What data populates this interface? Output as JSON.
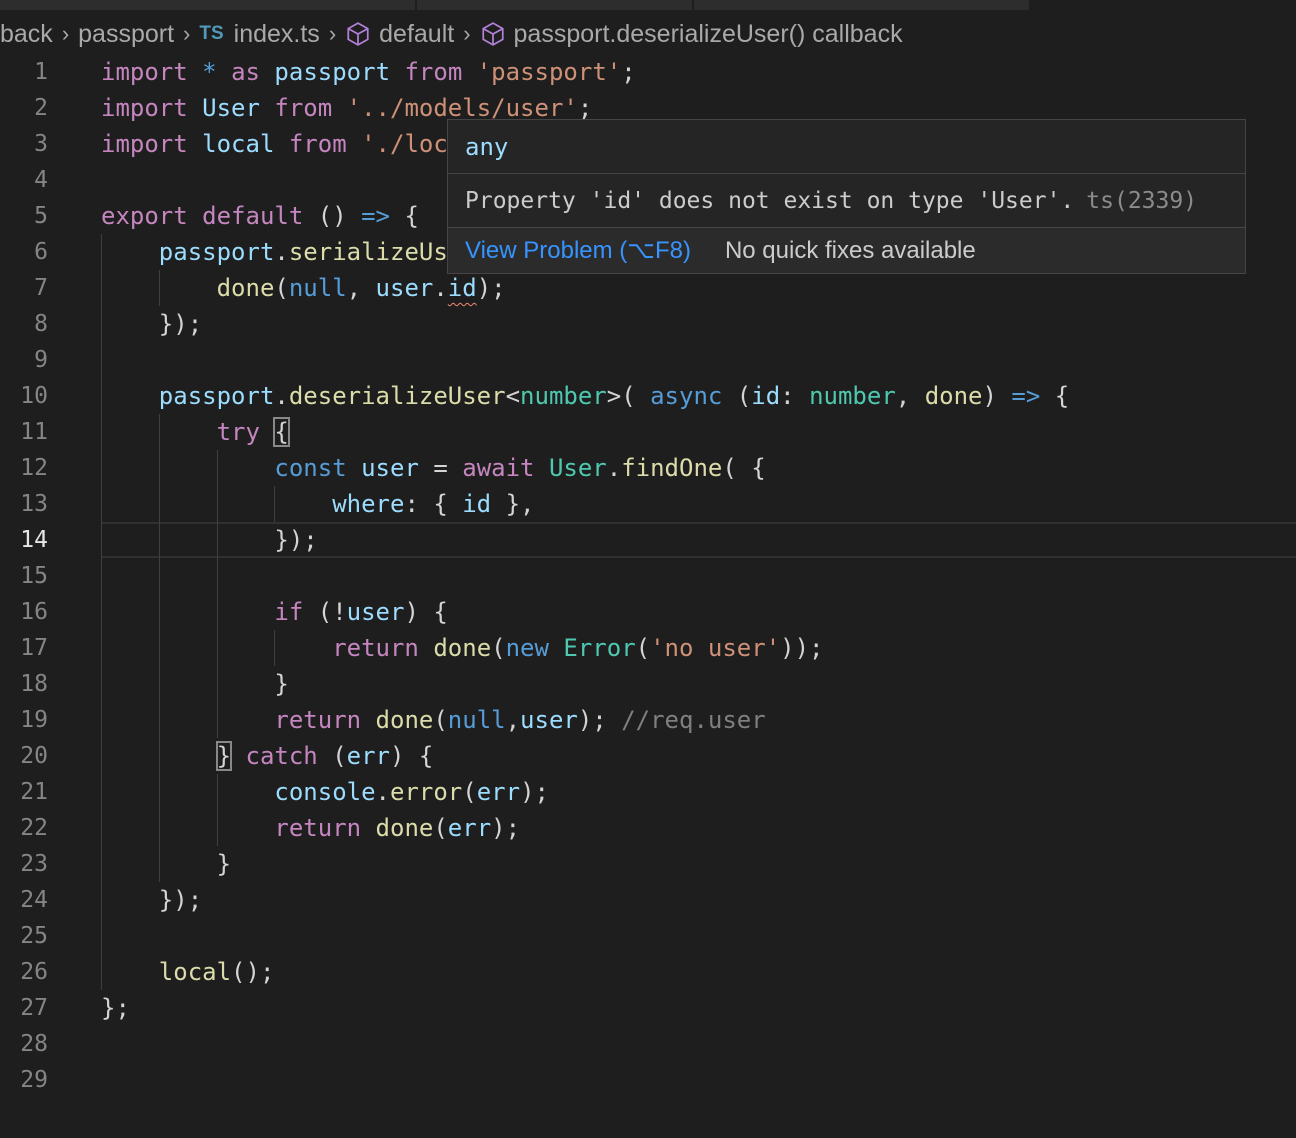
{
  "breadcrumb": {
    "items": [
      "back",
      "passport",
      "index.ts",
      "default",
      "passport.deserializeUser() callback"
    ],
    "file_badge": "TS"
  },
  "colors": {
    "kw": "#c586c0",
    "var": "#9cdcfe",
    "str": "#ce9178",
    "fn": "#dcdcaa",
    "type": "#4ec9b0",
    "blue": "#569cd6",
    "cmt": "#7f7f7f",
    "txt": "#d4d4d4",
    "background": "#1e1e1e",
    "link": "#3794ff"
  },
  "editor": {
    "current_line": 14,
    "line_numbers": [
      "1",
      "2",
      "3",
      "4",
      "5",
      "6",
      "7",
      "8",
      "9",
      "10",
      "11",
      "12",
      "13",
      "14",
      "15",
      "16",
      "17",
      "18",
      "19",
      "20",
      "21",
      "22",
      "23",
      "24",
      "25",
      "26",
      "27",
      "28",
      "29"
    ],
    "lines": [
      [
        [
          "import",
          "kw"
        ],
        [
          " ",
          "txt"
        ],
        [
          "*",
          "blue"
        ],
        [
          " ",
          "txt"
        ],
        [
          "as",
          "kw"
        ],
        [
          " ",
          "txt"
        ],
        [
          "passport",
          "var"
        ],
        [
          " ",
          "txt"
        ],
        [
          "from",
          "kw"
        ],
        [
          " ",
          "txt"
        ],
        [
          "'passport'",
          "str"
        ],
        [
          ";",
          "txt"
        ]
      ],
      [
        [
          "import",
          "kw"
        ],
        [
          " ",
          "txt"
        ],
        [
          "User",
          "var"
        ],
        [
          " ",
          "txt"
        ],
        [
          "from",
          "kw"
        ],
        [
          " ",
          "txt"
        ],
        [
          "'../models/user'",
          "str"
        ],
        [
          ";",
          "txt"
        ]
      ],
      [
        [
          "import",
          "kw"
        ],
        [
          " ",
          "txt"
        ],
        [
          "local",
          "var"
        ],
        [
          " ",
          "txt"
        ],
        [
          "from",
          "kw"
        ],
        [
          " ",
          "txt"
        ],
        [
          "'./loc",
          "str"
        ]
      ],
      [],
      [
        [
          "export",
          "kw"
        ],
        [
          " ",
          "txt"
        ],
        [
          "default",
          "kw"
        ],
        [
          " () ",
          "txt"
        ],
        [
          "=>",
          "blue"
        ],
        [
          " {",
          "txt"
        ]
      ],
      [
        [
          "    ",
          "txt"
        ],
        [
          "passport",
          "var"
        ],
        [
          ".",
          "txt"
        ],
        [
          "serializeUs",
          "fn"
        ]
      ],
      [
        [
          "        ",
          "txt"
        ],
        [
          "done",
          "fn"
        ],
        [
          "(",
          "txt"
        ],
        [
          "null",
          "blue"
        ],
        [
          ", ",
          "txt"
        ],
        [
          "user",
          "var"
        ],
        [
          ".",
          "txt"
        ],
        [
          "id",
          "var",
          "squig"
        ],
        [
          ");",
          "txt"
        ]
      ],
      [
        [
          "    });",
          "txt"
        ]
      ],
      [],
      [
        [
          "    ",
          "txt"
        ],
        [
          "passport",
          "var"
        ],
        [
          ".",
          "txt"
        ],
        [
          "deserializeUser",
          "fn"
        ],
        [
          "<",
          "txt"
        ],
        [
          "number",
          "type"
        ],
        [
          ">( ",
          "txt"
        ],
        [
          "async",
          "blue"
        ],
        [
          " (",
          "txt"
        ],
        [
          "id",
          "var"
        ],
        [
          ": ",
          "txt"
        ],
        [
          "number",
          "type"
        ],
        [
          ", ",
          "txt"
        ],
        [
          "done",
          "fn"
        ],
        [
          ") ",
          "txt"
        ],
        [
          "=>",
          "blue"
        ],
        [
          " {",
          "txt"
        ]
      ],
      [
        [
          "        ",
          "txt"
        ],
        [
          "try",
          "kw"
        ],
        [
          " ",
          "txt"
        ],
        [
          "{",
          "txt",
          "box"
        ]
      ],
      [
        [
          "            ",
          "txt"
        ],
        [
          "const",
          "blue"
        ],
        [
          " ",
          "txt"
        ],
        [
          "user",
          "var"
        ],
        [
          " = ",
          "txt"
        ],
        [
          "await",
          "kw"
        ],
        [
          " ",
          "txt"
        ],
        [
          "User",
          "type"
        ],
        [
          ".",
          "txt"
        ],
        [
          "findOne",
          "fn"
        ],
        [
          "( {",
          "txt"
        ]
      ],
      [
        [
          "                ",
          "txt"
        ],
        [
          "where",
          "var"
        ],
        [
          ": { ",
          "txt"
        ],
        [
          "id",
          "var"
        ],
        [
          " },",
          "txt"
        ]
      ],
      [
        [
          "            });",
          "txt"
        ]
      ],
      [],
      [
        [
          "            ",
          "txt"
        ],
        [
          "if",
          "kw"
        ],
        [
          " (!",
          "txt"
        ],
        [
          "user",
          "var"
        ],
        [
          ") {",
          "txt"
        ]
      ],
      [
        [
          "                ",
          "txt"
        ],
        [
          "return",
          "kw"
        ],
        [
          " ",
          "txt"
        ],
        [
          "done",
          "fn"
        ],
        [
          "(",
          "txt"
        ],
        [
          "new",
          "blue"
        ],
        [
          " ",
          "txt"
        ],
        [
          "Error",
          "type"
        ],
        [
          "(",
          "txt"
        ],
        [
          "'no user'",
          "str"
        ],
        [
          "));",
          "txt"
        ]
      ],
      [
        [
          "            }",
          "txt"
        ]
      ],
      [
        [
          "            ",
          "txt"
        ],
        [
          "return",
          "kw"
        ],
        [
          " ",
          "txt"
        ],
        [
          "done",
          "fn"
        ],
        [
          "(",
          "txt"
        ],
        [
          "null",
          "blue"
        ],
        [
          ",",
          "txt"
        ],
        [
          "user",
          "var"
        ],
        [
          "); ",
          "txt"
        ],
        [
          "//req.user",
          "cmt"
        ]
      ],
      [
        [
          "        ",
          "txt"
        ],
        [
          "}",
          "txt",
          "box"
        ],
        [
          " ",
          "txt"
        ],
        [
          "catch",
          "kw"
        ],
        [
          " (",
          "txt"
        ],
        [
          "err",
          "var"
        ],
        [
          ") {",
          "txt"
        ]
      ],
      [
        [
          "            ",
          "txt"
        ],
        [
          "console",
          "var"
        ],
        [
          ".",
          "txt"
        ],
        [
          "error",
          "fn"
        ],
        [
          "(",
          "txt"
        ],
        [
          "err",
          "var"
        ],
        [
          ");",
          "txt"
        ]
      ],
      [
        [
          "            ",
          "txt"
        ],
        [
          "return",
          "kw"
        ],
        [
          " ",
          "txt"
        ],
        [
          "done",
          "fn"
        ],
        [
          "(",
          "txt"
        ],
        [
          "err",
          "var"
        ],
        [
          ");",
          "txt"
        ]
      ],
      [
        [
          "        }",
          "txt"
        ]
      ],
      [
        [
          "    });",
          "txt"
        ]
      ],
      [],
      [
        [
          "    ",
          "txt"
        ],
        [
          "local",
          "fn"
        ],
        [
          "();",
          "txt"
        ]
      ],
      [
        [
          "};",
          "txt"
        ]
      ],
      [],
      []
    ]
  },
  "hover": {
    "type": "any",
    "message": "Property 'id' does not exist on type 'User'.",
    "code": "ts(2339)",
    "view_problem": "View Problem (⌥F8)",
    "no_fixes": "No quick fixes available"
  }
}
